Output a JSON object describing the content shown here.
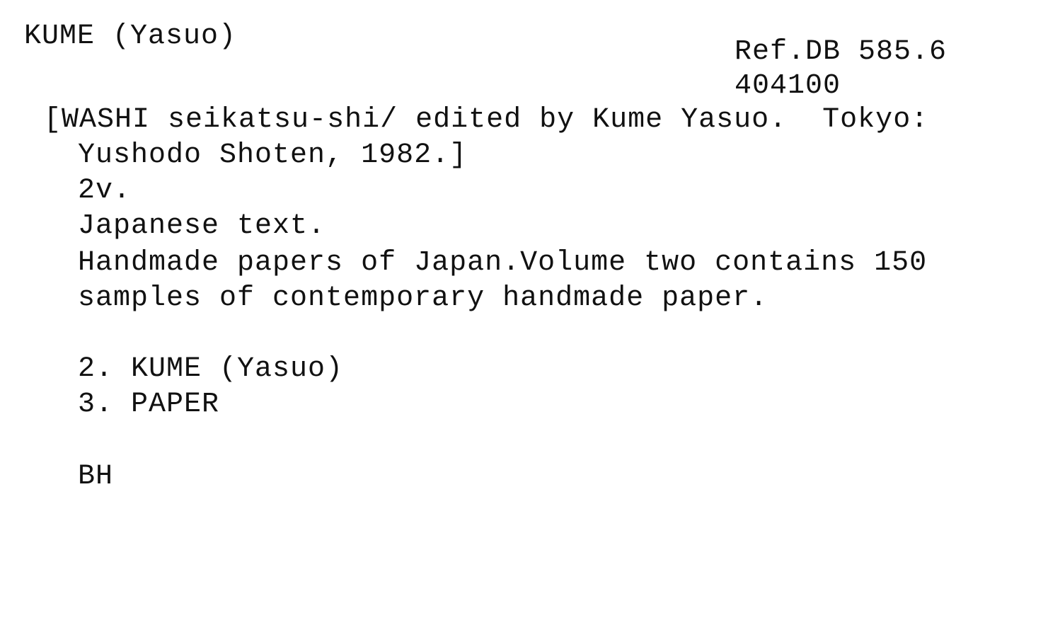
{
  "card": {
    "heading": "KUME (Yasuo)",
    "call_number": "Ref.DB 585.6",
    "accession_number": "404100",
    "title_line1": "[WASHI seikatsu-shi/ edited by Kume Yasuo.  Tokyo:",
    "title_line2": "Yushodo Shoten, 1982.]",
    "collation": "2v.",
    "language_note": "Japanese text.",
    "note_line1": "Handmade papers of Japan.Volume two contains 150",
    "note_line2": "samples of contemporary handmade paper.",
    "tracings": [
      "2. KUME (Yasuo)",
      "3. PAPER"
    ],
    "initials": "BH"
  }
}
